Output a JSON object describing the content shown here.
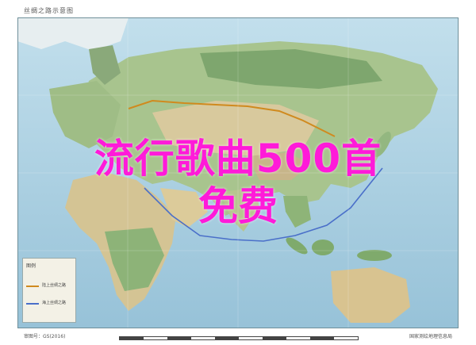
{
  "map": {
    "title": "丝绸之路示意图",
    "legend": {
      "title": "图例",
      "items": [
        {
          "label": "陆上丝绸之路",
          "color": "#d08a1e"
        },
        {
          "label": "海上丝绸之路",
          "color": "#4a6fc9"
        }
      ]
    },
    "footer_left": "审图号：GS(2016)",
    "footer_right": "国家测绘地理信息局"
  },
  "overlay": {
    "line1": "流行歌曲500首",
    "line2": "免费",
    "color": "#ff1ad9"
  },
  "colors": {
    "ocean": "#a9cde0",
    "land_green": "#9fc089",
    "land_tan": "#d6c79a",
    "land_dark": "#6f9a63",
    "land_route": "#d08a1e",
    "sea_route": "#4a6fc9"
  }
}
